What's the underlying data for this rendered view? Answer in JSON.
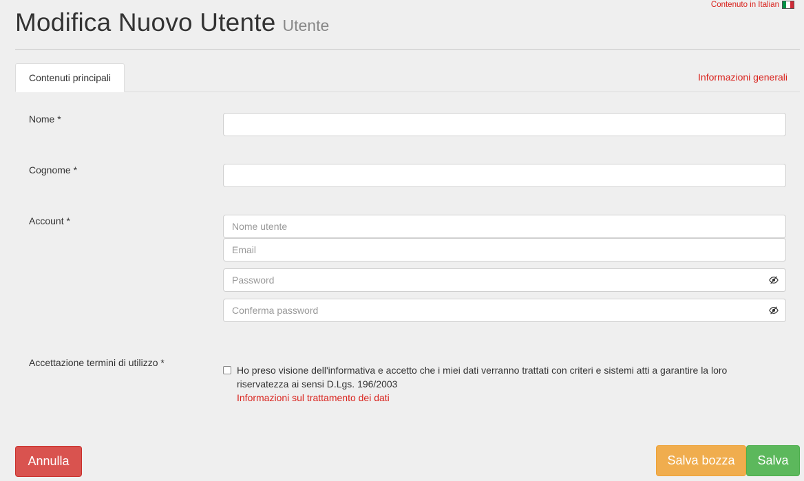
{
  "language_note": {
    "text": "Contenuto in Italian",
    "flag_colors": [
      "#009246",
      "#ffffff",
      "#ce2b37"
    ]
  },
  "header": {
    "title": "Modifica Nuovo Utente",
    "subtitle": "Utente"
  },
  "tabs": {
    "active": "Contenuti principali",
    "right_link": "Informazioni generali"
  },
  "form": {
    "nome": {
      "label": "Nome *",
      "value": ""
    },
    "cognome": {
      "label": "Cognome *",
      "value": ""
    },
    "account": {
      "label": "Account *",
      "username_placeholder": "Nome utente",
      "email_placeholder": "Email",
      "password_placeholder": "Password",
      "confirm_password_placeholder": "Conferma password"
    },
    "terms": {
      "label": "Accettazione termini di utilizzo *",
      "checked": false,
      "text": "Ho preso visione dell'informativa e accetto che i miei dati verranno trattati con criteri e sistemi atti a garantire la loro riservatezza ai sensi D.Lgs. 196/2003",
      "link": "Informazioni sul trattamento dei dati"
    }
  },
  "buttons": {
    "cancel": "Annulla",
    "save_draft": "Salva bozza",
    "save": "Salva"
  },
  "colors": {
    "accent_red": "#d9221c",
    "cancel": "#d9534f",
    "draft": "#f0ad4e",
    "save": "#5cb85c"
  }
}
